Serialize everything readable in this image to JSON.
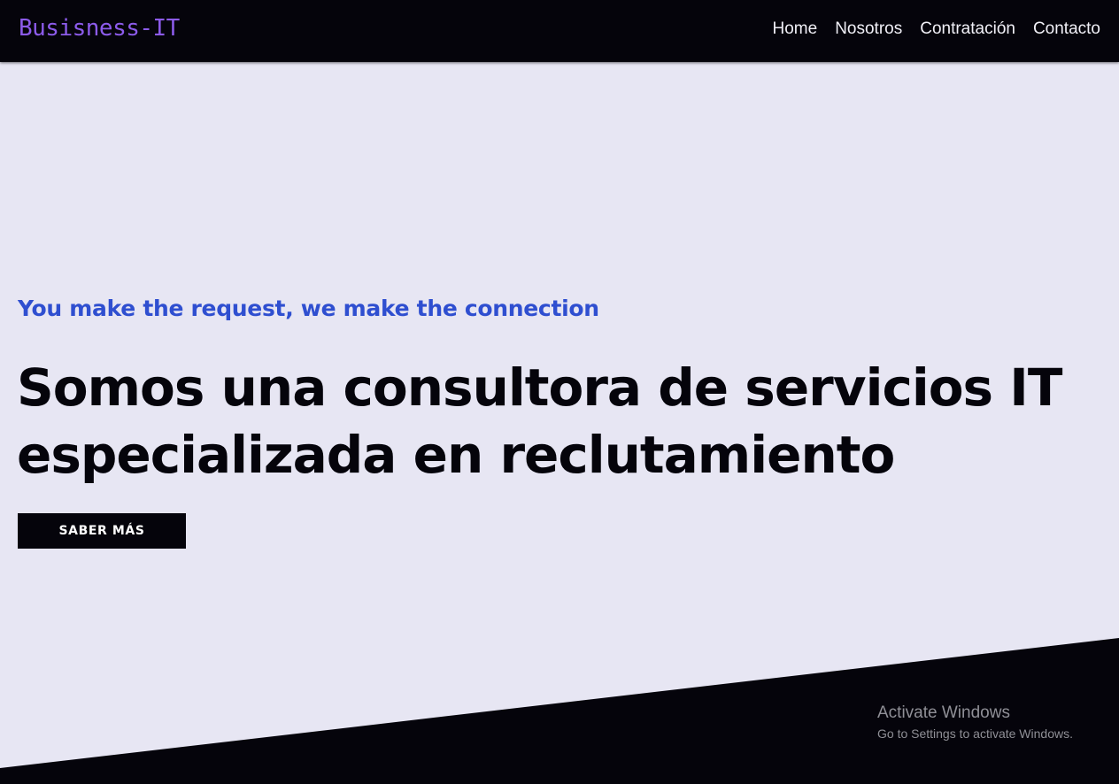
{
  "nav": {
    "logo": "Busisness-IT",
    "links": [
      {
        "label": "Home"
      },
      {
        "label": "Nosotros"
      },
      {
        "label": "Contratación"
      },
      {
        "label": "Contacto"
      }
    ]
  },
  "hero": {
    "tagline": "You make the request, we make the connection",
    "headline": "Somos una consultora de servicios IT especializada en reclutamiento",
    "cta_label": "SABER MÁS"
  },
  "watermark": {
    "title": "Activate Windows",
    "subtitle": "Go to Settings to activate Windows."
  },
  "colors": {
    "background": "#e7e6f3",
    "navbar": "#05040b",
    "logo": "#8c5bea",
    "tagline": "#2f4fd0",
    "headline": "#05040b",
    "button": "#05040b"
  }
}
